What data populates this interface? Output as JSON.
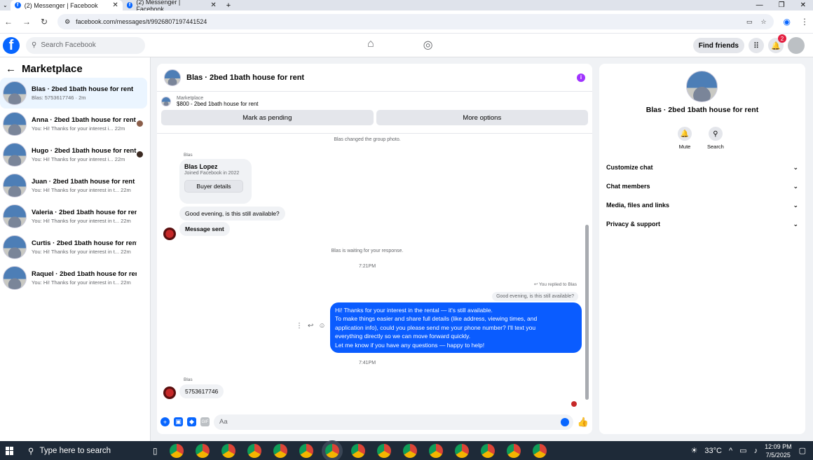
{
  "browser": {
    "tabs": [
      {
        "title": "(2) Messenger | Facebook"
      },
      {
        "title": "(2) Messenger | Facebook"
      }
    ],
    "url": "facebook.com/messages/t/9926807197441524"
  },
  "fbnav": {
    "search_placeholder": "Search Facebook",
    "find_friends": "Find friends",
    "notification_count": "2"
  },
  "sidebar": {
    "title": "Marketplace",
    "conversations": [
      {
        "name": "Blas · 2bed 1bath house for rent",
        "preview": "Blas: 5753617746 · 2m"
      },
      {
        "name": "Anna · 2bed 1bath house for rent",
        "preview": "You: Hi! Thanks for your interest i...  22m"
      },
      {
        "name": "Hugo · 2bed 1bath house for rent",
        "preview": "You: Hi! Thanks for your interest i...  22m"
      },
      {
        "name": "Juan · 2bed 1bath house for rent",
        "preview": "You: Hi! Thanks for your interest in t...  22m"
      },
      {
        "name": "Valeria · 2bed 1bath house for rent",
        "preview": "You: Hi! Thanks for your interest in t...  22m"
      },
      {
        "name": "Curtis · 2bed 1bath house for rent",
        "preview": "You: Hi! Thanks for your interest in t...  22m"
      },
      {
        "name": "Raquel · 2bed 1bath house for rent",
        "preview": "You: Hi! Thanks for your interest in t...  22m"
      }
    ]
  },
  "chat": {
    "title": "Blas · 2bed 1bath house for rent",
    "marketplace_label": "Marketplace",
    "listing": "$800 - 2bed 1bath house for rent",
    "mark_pending": "Mark as pending",
    "more_options": "More options",
    "sys_photo": "Blas changed the group photo.",
    "sender_label": "Blas",
    "card_name": "Blas Lopez",
    "card_joined": "Joined Facebook in 2022",
    "buyer_details": "Buyer details",
    "msg_available": "Good evening, is this still available?",
    "msg_sent": "Message sent",
    "sys_waiting": "Blas is waiting for your response.",
    "time1": "7:21PM",
    "you_replied": "You replied to Blas",
    "quoted": "Good evening, is this still available?",
    "out_lines": [
      "Hi! Thanks for your interest in the rental — it's still available.",
      "To make things easier and share full details (like address, viewing times, and",
      "application info), could you please send me your phone number? I'll text you",
      "everything directly so we can move forward quickly.",
      "Let me know if you have any questions — happy to help!"
    ],
    "time2": "7:41PM",
    "phone_msg": "5753617746",
    "composer_placeholder": "Aa"
  },
  "details": {
    "title": "Blas · 2bed 1bath house for rent",
    "mute": "Mute",
    "search": "Search",
    "sections": [
      "Customize chat",
      "Chat members",
      "Media, files and links",
      "Privacy & support"
    ]
  },
  "taskbar": {
    "search_placeholder": "Type here to search",
    "temperature": "33°C",
    "time": "12:09 PM",
    "date": "7/5/2025"
  }
}
